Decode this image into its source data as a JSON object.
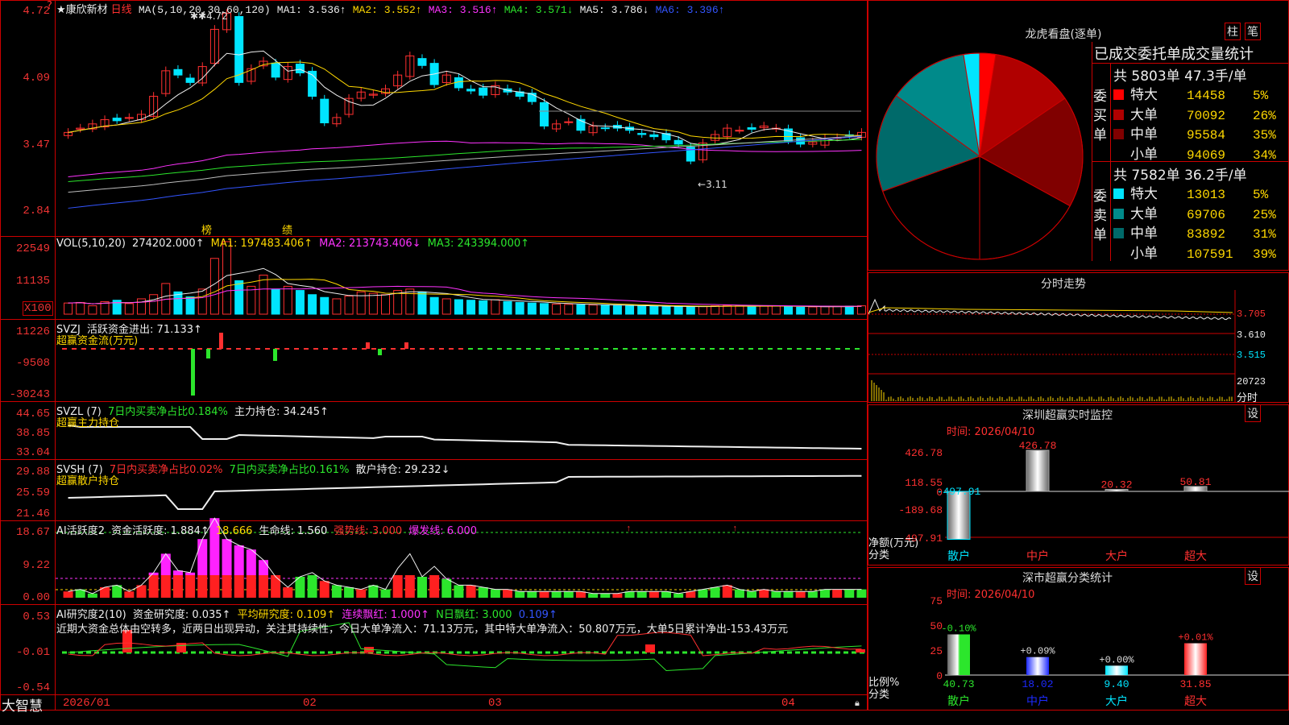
{
  "stock": {
    "name": "★康欣新材",
    "period": "日线"
  },
  "ma_header": {
    "label": "MA(5,10,20,30,60,120)",
    "ma1": "MA1: 3.536↑",
    "ma2": "MA2: 3.552↑",
    "ma3": "MA3: 3.516↑",
    "ma4": "MA4: 3.571↓",
    "ma5": "MA5: 3.786↓",
    "ma6": "MA6: 3.396↑"
  },
  "price_axis": [
    "4.72",
    "4.09",
    "3.47",
    "2.84"
  ],
  "price_marks": {
    "high": "4.72",
    "low": "3.11",
    "badge_a": "榜",
    "badge_b": "绩"
  },
  "vol_header": {
    "label": "VOL(5,10,20)",
    "v": "274202.000↑",
    "ma1": "MA1: 197483.406↑",
    "ma2": "MA2: 213743.406↓",
    "ma3": "MA3: 243394.000↑"
  },
  "vol_axis": [
    "22549",
    "11135"
  ],
  "vol_unit": "X100",
  "svzj": {
    "label": "SVZJ",
    "text": "活跃资金进出: 71.133↑",
    "sub": "超赢资金流(万元)",
    "axis": [
      "11226",
      "-9508",
      "-30243"
    ]
  },
  "svzl": {
    "label": "SVZL (7)",
    "t1": "7日内买卖净占比0.184%",
    "t2": "主力持仓: 34.245↑",
    "sub": "超赢主力持仓",
    "axis": [
      "44.65",
      "38.85",
      "33.04"
    ]
  },
  "svsh": {
    "label": "SVSH (7)",
    "t1": "7日内买卖净占比0.02%",
    "t2": "7日内买卖净占比0.161%",
    "t3": "散户持仓: 29.232↓",
    "sub": "超赢散户持仓",
    "axis": [
      "29.88",
      "25.59",
      "21.46"
    ]
  },
  "ai_active": {
    "label": "AI活跃度2",
    "t1": "资金活跃度: 1.884↑",
    "t2": "18.666",
    "t3": "生命线: 1.560",
    "t4": "强势线: 3.000",
    "t5": "爆发线: 6.000",
    "axis": [
      "18.67",
      "9.22",
      "0.00"
    ]
  },
  "ai_research": {
    "label": "AI研究度2(10)",
    "t1": "资金研究度: 0.035↑",
    "t2": "平均研究度: 0.109↑",
    "t3": "连续飘红: 1.000↑",
    "t4": "N日飘红: 3.000",
    "t5": "0.109↑",
    "comment": "近期大资金总体由空转多，近两日出现异动，关注其持续性，今日大单净流入：71.13万元，其中特大单净流入：50.807万元，大单5日累计净出-153.43万元",
    "axis": [
      "0.53",
      "-0.01",
      "-0.54"
    ]
  },
  "bottom_axis": {
    "brand": "大智慧",
    "dates": [
      "2026/01",
      "02",
      "03",
      "04"
    ]
  },
  "dragon": {
    "title": "龙虎看盘(逐单)",
    "btn1": "柱",
    "btn2": "笔",
    "tabs": "已成交委托单成交量统计",
    "buy": {
      "side": "委买单",
      "total": "共 5803单 47.3手/单",
      "rows": [
        {
          "name": "特大",
          "vol": "14458",
          "pct": "5%",
          "color": "#ff0000"
        },
        {
          "name": "大单",
          "vol": "70092",
          "pct": "26%",
          "color": "#b00000"
        },
        {
          "name": "中单",
          "vol": "95584",
          "pct": "35%",
          "color": "#800000"
        },
        {
          "name": "小单",
          "vol": "94069",
          "pct": "34%",
          "color": "#000000"
        }
      ]
    },
    "sell": {
      "side": "委卖单",
      "total": "共 7582单 36.2手/单",
      "rows": [
        {
          "name": "特大",
          "vol": "13013",
          "pct": "5%",
          "color": "#00e5ff"
        },
        {
          "name": "大单",
          "vol": "69706",
          "pct": "25%",
          "color": "#008a8a"
        },
        {
          "name": "中单",
          "vol": "83892",
          "pct": "31%",
          "color": "#006a6a"
        },
        {
          "name": "小单",
          "vol": "107591",
          "pct": "39%",
          "color": "#000000"
        }
      ]
    }
  },
  "intraday": {
    "title": "分时走势",
    "axis": [
      "3.705",
      "3.610",
      "3.515"
    ],
    "vol": "20723",
    "vol_label": "分时"
  },
  "monitor": {
    "title": "深圳超赢实时监控",
    "btn": "设",
    "date": "时间: 2026/04/10",
    "axis": [
      "426.78",
      "118.55",
      "0",
      "-189.68",
      "-497.91"
    ],
    "ylabel": "净额(万元)",
    "xlabel": "分类",
    "cats": [
      "散户",
      "中户",
      "大户",
      "超大"
    ],
    "values": [
      "-497.91",
      "426.78",
      "20.32",
      "50.81"
    ]
  },
  "classify": {
    "title": "深市超赢分类统计",
    "btn": "设",
    "date": "时间: 2026/04/10",
    "axis": [
      "75",
      "50",
      "25",
      "0"
    ],
    "ylabel": "比例%",
    "xlabel": "分类",
    "cats": [
      "散户",
      "中户",
      "大户",
      "超大"
    ],
    "top": [
      "-0.10%",
      "+0.09%",
      "+0.00%",
      "+0.01%"
    ],
    "values": [
      "40.73",
      "18.02",
      "9.40",
      "31.85"
    ]
  }
}
